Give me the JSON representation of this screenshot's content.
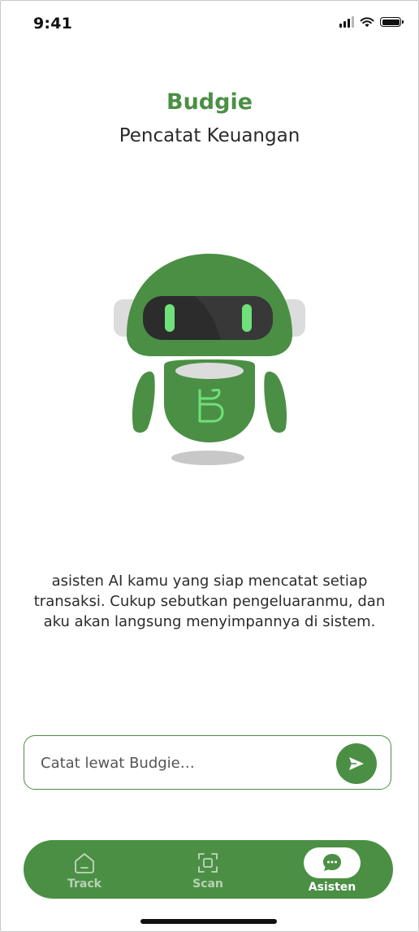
{
  "status_bar": {
    "time": "9:41"
  },
  "header": {
    "title": "Budgie",
    "subtitle": "Pencatat Keuangan"
  },
  "mascot": {
    "icon": "budgie-robot-mascot",
    "colors": {
      "body": "#4b8f45",
      "visor": "#2b2b2b",
      "eyes": "#6fe07a",
      "ears": "#dcdcdc"
    }
  },
  "description": {
    "lines": [
      "asisten AI kamu yang siap mencatat setiap",
      "transaksi. Cukup sebutkan pengeluaranmu, dan",
      "aku akan langsung menyimpannya di sistem."
    ]
  },
  "chat": {
    "placeholder": "Catat lewat Budgie…",
    "value": "",
    "send_icon": "send-icon"
  },
  "nav": {
    "items": [
      {
        "label": "Track",
        "icon": "home-icon",
        "active": false
      },
      {
        "label": "Scan",
        "icon": "scan-icon",
        "active": false
      },
      {
        "label": "Asisten",
        "icon": "chat-icon",
        "active": true
      }
    ]
  },
  "colors": {
    "accent": "#4b8f45",
    "background": "#ffffff",
    "text": "#2b2b2b"
  }
}
